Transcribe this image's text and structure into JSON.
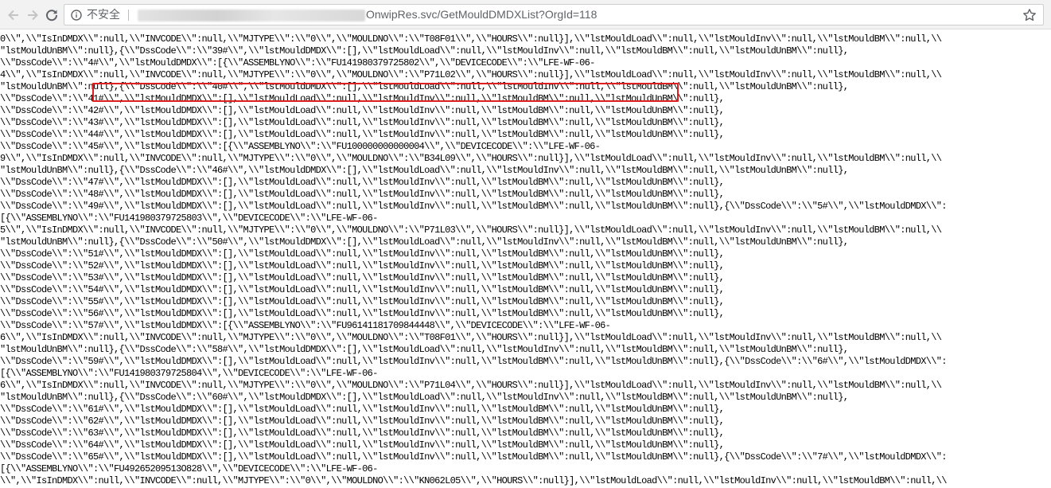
{
  "browser": {
    "security_label": "不安全",
    "url_path": "OnwipRes.svc/GetMouldDMDXList?OrgId=118"
  },
  "colors": {
    "highlight_box": "#e02020",
    "toolbar_bg": "#f2f2f2",
    "text": "#000000"
  },
  "icons": [
    "back-arrow-icon",
    "forward-arrow-icon",
    "reload-icon",
    "info-icon",
    "bookmark-star-icon"
  ],
  "lines": [
    "0\\\\\",\\\\\"IsInDMDX\\\\\":null,\\\\\"INVCODE\\\\\":null,\\\\\"MJTYPE\\\\\":\\\\\"0\\\\\",\\\\\"MOULDNO\\\\\":\\\\\"T08F01\\\\\",\\\\\"HOURS\\\\\":null}],\\\\\"lstMouldLoad\\\\\":null,\\\\\"lstMouldInv\\\\\":null,\\\\\"lstMouldBM\\\\\":null,\\\\",
    "\"lstMouldUnBM\\\\\":null},{\\\\\"DssCode\\\\\":\\\\\"39#\\\\\",\\\\\"lstMouldDMDX\\\\\":[],\\\\\"lstMouldLoad\\\\\":null,\\\\\"lstMouldInv\\\\\":null,\\\\\"lstMouldBM\\\\\":null,\\\\\"lstMouldUnBM\\\\\":null},",
    "\\\\\"DssCode\\\\\":\\\\\"4#\\\\\",\\\\\"lstMouldDMDX\\\\\":[{\\\\\"ASSEMBLYNO\\\\\":\\\\\"FU141980379725802\\\\\",\\\\\"DEVICECODE\\\\\":\\\\\"LFE-WF-06-",
    "4\\\\\",\\\\\"IsInDMDX\\\\\":null,\\\\\"INVCODE\\\\\":null,\\\\\"MJTYPE\\\\\":\\\\\"0\\\\\",\\\\\"MOULDNO\\\\\":\\\\\"P71L02\\\\\",\\\\\"HOURS\\\\\":null}],\\\\\"lstMouldLoad\\\\\":null,\\\\\"lstMouldInv\\\\\":null,\\\\\"lstMouldBM\\\\\":null,\\\\",
    "\"lstMouldUnBM\\\\\":null},{\\\\\"DssCode\\\\\":\\\\\"40#\\\\\",\\\\\"lstMouldDMDX\\\\\":[],\\\\\"lstMouldLoad\\\\\":null,\\\\\"lstMouldInv\\\\\":null,\\\\\"lstMouldBM\\\\\":null,\\\\\"lstMouldUnBM\\\\\":null},",
    "\\\\\"DssCode\\\\\":\\\\\"41#\\\\\",\\\\\"lstMouldDMDX\\\\\":[],\\\\\"lstMouldLoad\\\\\":null,\\\\\"lstMouldInv\\\\\":null,\\\\\"lstMouldBM\\\\\":null,\\\\\"lstMouldUnBM\\\\\":null},",
    "\\\\\"DssCode\\\\\":\\\\\"42#\\\\\",\\\\\"lstMouldDMDX\\\\\":[],\\\\\"lstMouldLoad\\\\\":null,\\\\\"lstMouldInv\\\\\":null,\\\\\"lstMouldBM\\\\\":null,\\\\\"lstMouldUnBM\\\\\":null},",
    "\\\\\"DssCode\\\\\":\\\\\"43#\\\\\",\\\\\"lstMouldDMDX\\\\\":[],\\\\\"lstMouldLoad\\\\\":null,\\\\\"lstMouldInv\\\\\":null,\\\\\"lstMouldBM\\\\\":null,\\\\\"lstMouldUnBM\\\\\":null},",
    "\\\\\"DssCode\\\\\":\\\\\"44#\\\\\",\\\\\"lstMouldDMDX\\\\\":[],\\\\\"lstMouldLoad\\\\\":null,\\\\\"lstMouldInv\\\\\":null,\\\\\"lstMouldBM\\\\\":null,\\\\\"lstMouldUnBM\\\\\":null},",
    "\\\\\"DssCode\\\\\":\\\\\"45#\\\\\",\\\\\"lstMouldDMDX\\\\\":[{\\\\\"ASSEMBLYNO\\\\\":\\\\\"FU100000000000004\\\\\",\\\\\"DEVICECODE\\\\\":\\\\\"LFE-WF-06-",
    "9\\\\\",\\\\\"IsInDMDX\\\\\":null,\\\\\"INVCODE\\\\\":null,\\\\\"MJTYPE\\\\\":\\\\\"0\\\\\",\\\\\"MOULDNO\\\\\":\\\\\"B34L09\\\\\",\\\\\"HOURS\\\\\":null}],\\\\\"lstMouldLoad\\\\\":null,\\\\\"lstMouldInv\\\\\":null,\\\\\"lstMouldBM\\\\\":null,\\\\",
    "\"lstMouldUnBM\\\\\":null},{\\\\\"DssCode\\\\\":\\\\\"46#\\\\\",\\\\\"lstMouldDMDX\\\\\":[],\\\\\"lstMouldLoad\\\\\":null,\\\\\"lstMouldInv\\\\\":null,\\\\\"lstMouldBM\\\\\":null,\\\\\"lstMouldUnBM\\\\\":null},",
    "\\\\\"DssCode\\\\\":\\\\\"47#\\\\\",\\\\\"lstMouldDMDX\\\\\":[],\\\\\"lstMouldLoad\\\\\":null,\\\\\"lstMouldInv\\\\\":null,\\\\\"lstMouldBM\\\\\":null,\\\\\"lstMouldUnBM\\\\\":null},",
    "\\\\\"DssCode\\\\\":\\\\\"48#\\\\\",\\\\\"lstMouldDMDX\\\\\":[],\\\\\"lstMouldLoad\\\\\":null,\\\\\"lstMouldInv\\\\\":null,\\\\\"lstMouldBM\\\\\":null,\\\\\"lstMouldUnBM\\\\\":null},",
    "\\\\\"DssCode\\\\\":\\\\\"49#\\\\\",\\\\\"lstMouldDMDX\\\\\":[],\\\\\"lstMouldLoad\\\\\":null,\\\\\"lstMouldInv\\\\\":null,\\\\\"lstMouldBM\\\\\":null,\\\\\"lstMouldUnBM\\\\\":null},{\\\\\"DssCode\\\\\":\\\\\"5#\\\\\",\\\\\"lstMouldDMDX\\\\\":",
    "[{\\\\\"ASSEMBLYNO\\\\\":\\\\\"FU141980379725803\\\\\",\\\\\"DEVICECODE\\\\\":\\\\\"LFE-WF-06-",
    "5\\\\\",\\\\\"IsInDMDX\\\\\":null,\\\\\"INVCODE\\\\\":null,\\\\\"MJTYPE\\\\\":\\\\\"0\\\\\",\\\\\"MOULDNO\\\\\":\\\\\"P71L03\\\\\",\\\\\"HOURS\\\\\":null}],\\\\\"lstMouldLoad\\\\\":null,\\\\\"lstMouldInv\\\\\":null,\\\\\"lstMouldBM\\\\\":null,\\\\",
    "\"lstMouldUnBM\\\\\":null},{\\\\\"DssCode\\\\\":\\\\\"50#\\\\\",\\\\\"lstMouldDMDX\\\\\":[],\\\\\"lstMouldLoad\\\\\":null,\\\\\"lstMouldInv\\\\\":null,\\\\\"lstMouldBM\\\\\":null,\\\\\"lstMouldUnBM\\\\\":null},",
    "\\\\\"DssCode\\\\\":\\\\\"51#\\\\\",\\\\\"lstMouldDMDX\\\\\":[],\\\\\"lstMouldLoad\\\\\":null,\\\\\"lstMouldInv\\\\\":null,\\\\\"lstMouldBM\\\\\":null,\\\\\"lstMouldUnBM\\\\\":null},",
    "\\\\\"DssCode\\\\\":\\\\\"52#\\\\\",\\\\\"lstMouldDMDX\\\\\":[],\\\\\"lstMouldLoad\\\\\":null,\\\\\"lstMouldInv\\\\\":null,\\\\\"lstMouldBM\\\\\":null,\\\\\"lstMouldUnBM\\\\\":null},",
    "\\\\\"DssCode\\\\\":\\\\\"53#\\\\\",\\\\\"lstMouldDMDX\\\\\":[],\\\\\"lstMouldLoad\\\\\":null,\\\\\"lstMouldInv\\\\\":null,\\\\\"lstMouldBM\\\\\":null,\\\\\"lstMouldUnBM\\\\\":null},",
    "\\\\\"DssCode\\\\\":\\\\\"54#\\\\\",\\\\\"lstMouldDMDX\\\\\":[],\\\\\"lstMouldLoad\\\\\":null,\\\\\"lstMouldInv\\\\\":null,\\\\\"lstMouldBM\\\\\":null,\\\\\"lstMouldUnBM\\\\\":null},",
    "\\\\\"DssCode\\\\\":\\\\\"55#\\\\\",\\\\\"lstMouldDMDX\\\\\":[],\\\\\"lstMouldLoad\\\\\":null,\\\\\"lstMouldInv\\\\\":null,\\\\\"lstMouldBM\\\\\":null,\\\\\"lstMouldUnBM\\\\\":null},",
    "\\\\\"DssCode\\\\\":\\\\\"56#\\\\\",\\\\\"lstMouldDMDX\\\\\":[],\\\\\"lstMouldLoad\\\\\":null,\\\\\"lstMouldInv\\\\\":null,\\\\\"lstMouldBM\\\\\":null,\\\\\"lstMouldUnBM\\\\\":null},",
    "\\\\\"DssCode\\\\\":\\\\\"57#\\\\\",\\\\\"lstMouldDMDX\\\\\":[{\\\\\"ASSEMBLYNO\\\\\":\\\\\"FU96141181709844448\\\\\",\\\\\"DEVICECODE\\\\\":\\\\\"LFE-WF-06-",
    "6\\\\\",\\\\\"IsInDMDX\\\\\":null,\\\\\"INVCODE\\\\\":null,\\\\\"MJTYPE\\\\\":\\\\\"0\\\\\",\\\\\"MOULDNO\\\\\":\\\\\"T08F01\\\\\",\\\\\"HOURS\\\\\":null}],\\\\\"lstMouldLoad\\\\\":null,\\\\\"lstMouldInv\\\\\":null,\\\\\"lstMouldBM\\\\\":null,\\\\",
    "\"lstMouldUnBM\\\\\":null},{\\\\\"DssCode\\\\\":\\\\\"58#\\\\\",\\\\\"lstMouldDMDX\\\\\":[],\\\\\"lstMouldLoad\\\\\":null,\\\\\"lstMouldInv\\\\\":null,\\\\\"lstMouldBM\\\\\":null,\\\\\"lstMouldUnBM\\\\\":null},",
    "\\\\\"DssCode\\\\\":\\\\\"59#\\\\\",\\\\\"lstMouldDMDX\\\\\":[],\\\\\"lstMouldLoad\\\\\":null,\\\\\"lstMouldInv\\\\\":null,\\\\\"lstMouldBM\\\\\":null,\\\\\"lstMouldUnBM\\\\\":null},{\\\\\"DssCode\\\\\":\\\\\"6#\\\\\",\\\\\"lstMouldDMDX\\\\\":",
    "[{\\\\\"ASSEMBLYNO\\\\\":\\\\\"FU141980379725804\\\\\",\\\\\"DEVICECODE\\\\\":\\\\\"LFE-WF-06-",
    "6\\\\\",\\\\\"IsInDMDX\\\\\":null,\\\\\"INVCODE\\\\\":null,\\\\\"MJTYPE\\\\\":\\\\\"0\\\\\",\\\\\"MOULDNO\\\\\":\\\\\"P71L04\\\\\",\\\\\"HOURS\\\\\":null}],\\\\\"lstMouldLoad\\\\\":null,\\\\\"lstMouldInv\\\\\":null,\\\\\"lstMouldBM\\\\\":null,\\\\",
    "\"lstMouldUnBM\\\\\":null},{\\\\\"DssCode\\\\\":\\\\\"60#\\\\\",\\\\\"lstMouldDMDX\\\\\":[],\\\\\"lstMouldLoad\\\\\":null,\\\\\"lstMouldInv\\\\\":null,\\\\\"lstMouldBM\\\\\":null,\\\\\"lstMouldUnBM\\\\\":null},",
    "\\\\\"DssCode\\\\\":\\\\\"61#\\\\\",\\\\\"lstMouldDMDX\\\\\":[],\\\\\"lstMouldLoad\\\\\":null,\\\\\"lstMouldInv\\\\\":null,\\\\\"lstMouldBM\\\\\":null,\\\\\"lstMouldUnBM\\\\\":null},",
    "\\\\\"DssCode\\\\\":\\\\\"62#\\\\\",\\\\\"lstMouldDMDX\\\\\":[],\\\\\"lstMouldLoad\\\\\":null,\\\\\"lstMouldInv\\\\\":null,\\\\\"lstMouldBM\\\\\":null,\\\\\"lstMouldUnBM\\\\\":null},",
    "\\\\\"DssCode\\\\\":\\\\\"63#\\\\\",\\\\\"lstMouldDMDX\\\\\":[],\\\\\"lstMouldLoad\\\\\":null,\\\\\"lstMouldInv\\\\\":null,\\\\\"lstMouldBM\\\\\":null,\\\\\"lstMouldUnBM\\\\\":null},",
    "\\\\\"DssCode\\\\\":\\\\\"64#\\\\\",\\\\\"lstMouldDMDX\\\\\":[],\\\\\"lstMouldLoad\\\\\":null,\\\\\"lstMouldInv\\\\\":null,\\\\\"lstMouldBM\\\\\":null,\\\\\"lstMouldUnBM\\\\\":null},",
    "\\\\\"DssCode\\\\\":\\\\\"65#\\\\\",\\\\\"lstMouldDMDX\\\\\":[],\\\\\"lstMouldLoad\\\\\":null,\\\\\"lstMouldInv\\\\\":null,\\\\\"lstMouldBM\\\\\":null,\\\\\"lstMouldUnBM\\\\\":null},{\\\\\"DssCode\\\\\":\\\\\"7#\\\\\",\\\\\"lstMouldDMDX\\\\\":",
    "[{\\\\\"ASSEMBLYNO\\\\\":\\\\\"FU49265209513O828\\\\\",\\\\\"DEVICECODE\\\\\":\\\\\"LFE-WF-06-",
    "\\\\\",\\\\\"IsInDMDX\\\\\":null,\\\\\"INVCODE\\\\\":null,\\\\\"MJTYPE\\\\\":\\\\\"0\\\\\",\\\\\"MOULDNO\\\\\":\\\\\"KN062L05\\\\\",\\\\\"HOURS\\\\\":null}],\\\\\"lstMouldLoad\\\\\":null,\\\\\"lstMouldInv\\\\\":null,\\\\\"lstMouldBM\\\\\":null,\\\\"
  ]
}
